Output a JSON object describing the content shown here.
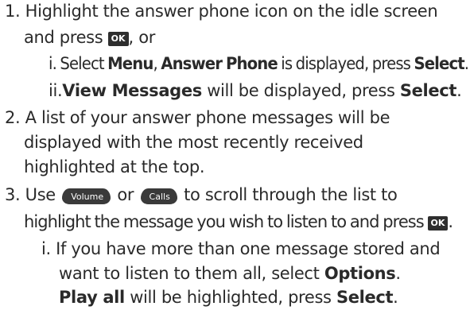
{
  "step1": {
    "number": "1.",
    "line1": "Highlight the answer phone icon on the idle screen",
    "line2_pre": "and press ",
    "ok_key": "OK",
    "line2_post": ", or",
    "sub_i": {
      "marker": "i.",
      "t1": " Select ",
      "b1": "Menu",
      "t2": ", ",
      "b2": "Answer Phone",
      "t3": " is displayed, press ",
      "b3": "Select",
      "t4": "."
    },
    "sub_ii": {
      "marker": "ii.",
      "b1": "View Messages",
      "t1": " will be displayed, press ",
      "b2": "Select",
      "t2": "."
    }
  },
  "step2": {
    "number": "2.",
    "line1": "A list of your answer phone messages will be",
    "line2": "displayed with the most recently received",
    "line3": "highlighted at the top."
  },
  "step3": {
    "number": "3.",
    "use": "Use ",
    "volume_key": "Volume",
    "or": " or ",
    "calls_key": "Calls",
    "line1_post": " to scroll through the list to",
    "line2_pre": "highlight the message you wish to listen to and press ",
    "ok_key": "OK",
    "line2_post": ".",
    "sub_i": {
      "marker": "i.",
      "line1": "If you have more than one message stored and",
      "line2_pre": "want to listen to them all, select ",
      "line2_bold": "Options",
      "line2_post": ".",
      "line3_bold1": "Play all",
      "line3_mid": " will be highlighted, press ",
      "line3_bold2": "Select",
      "line3_post": "."
    }
  }
}
